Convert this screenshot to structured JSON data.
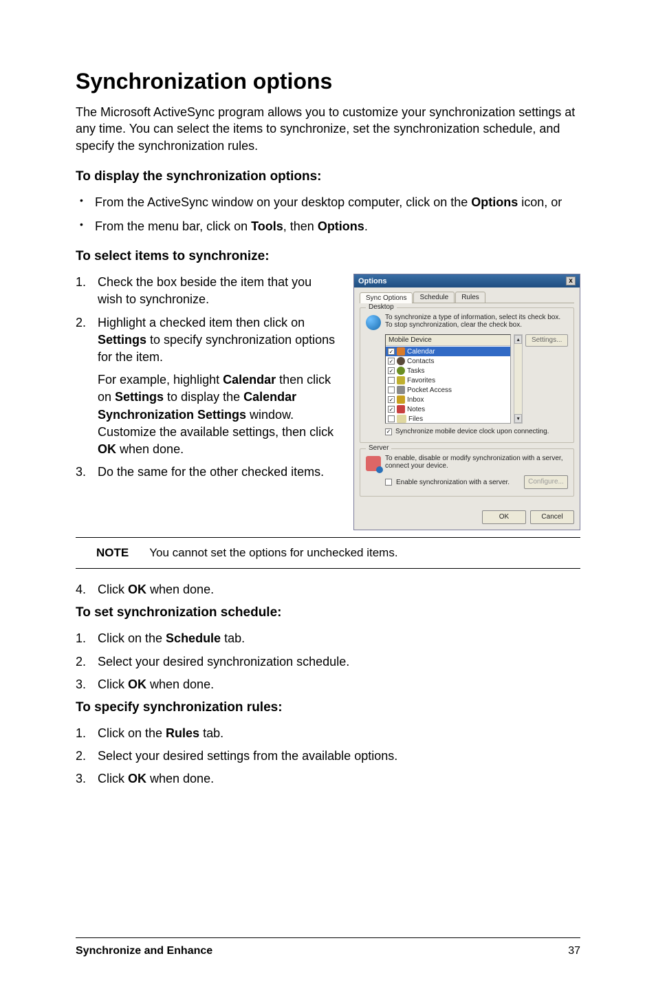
{
  "title": "Synchronization options",
  "intro": "The Microsoft ActiveSync program allows you to customize your synchronization settings at any time. You can select the items to synchronize, set the synchronization schedule, and specify the synchronization rules.",
  "h_display": "To display the synchronization options:",
  "display_bullets": {
    "b1_pre": "From the ActiveSync window on your desktop computer, click on the ",
    "b1_bold": "Options",
    "b1_post": " icon, or",
    "b2_pre": "From the menu bar, click on ",
    "b2_bold1": "Tools",
    "b2_mid": ", then ",
    "b2_bold2": "Options",
    "b2_post": "."
  },
  "h_select": "To select items to synchronize:",
  "select_steps": {
    "s1": "Check the box beside the item that you wish to synchronize.",
    "s2_pre": "Highlight a checked item then click on ",
    "s2_bold": "Settings",
    "s2_post": " to specify synchronization options for the item.",
    "s2_sub_pre": "For example, highlight ",
    "s2_sub_b1": "Calendar",
    "s2_sub_mid1": " then click on ",
    "s2_sub_b2": "Settings",
    "s2_sub_mid2": " to display the ",
    "s2_sub_b3": "Calendar Synchronization Settings",
    "s2_sub_mid3": " window. Customize the available settings, then click ",
    "s2_sub_b4": "OK",
    "s2_sub_post": " when done.",
    "s3": "Do the same for the other checked items."
  },
  "note_label": "NOTE",
  "note_text": "You cannot set the options for unchecked items.",
  "step4_pre": "Click ",
  "step4_bold": "OK",
  "step4_post": " when done.",
  "h_schedule": "To set synchronization schedule:",
  "schedule_steps": {
    "s1_pre": "Click on the ",
    "s1_bold": "Schedule",
    "s1_post": " tab.",
    "s2": "Select your desired synchronization schedule.",
    "s3_pre": "Click ",
    "s3_bold": "OK",
    "s3_post": " when done."
  },
  "h_rules": "To specify synchronization rules:",
  "rules_steps": {
    "s1_pre": "Click on the ",
    "s1_bold": "Rules",
    "s1_post": " tab.",
    "s2": "Select your desired settings from the available options.",
    "s3_pre": "Click ",
    "s3_bold": "OK",
    "s3_post": " when done."
  },
  "footer": {
    "title": "Synchronize and Enhance",
    "page": "37"
  },
  "dialog": {
    "title": "Options",
    "close": "x",
    "tabs": {
      "t1": "Sync Options",
      "t2": "Schedule",
      "t3": "Rules"
    },
    "desktop": {
      "legend": "Desktop",
      "msg": "To synchronize a type of information, select its check box. To stop synchronization, clear the check box.",
      "header": "Mobile Device",
      "settings_btn": "Settings...",
      "items": [
        {
          "label": "Calendar",
          "checked": true,
          "selected": true,
          "icon": "cal"
        },
        {
          "label": "Contacts",
          "checked": true,
          "selected": false,
          "icon": "cont"
        },
        {
          "label": "Tasks",
          "checked": true,
          "selected": false,
          "icon": "task"
        },
        {
          "label": "Favorites",
          "checked": false,
          "selected": false,
          "icon": "fav"
        },
        {
          "label": "Pocket Access",
          "checked": false,
          "selected": false,
          "icon": "pa"
        },
        {
          "label": "Inbox",
          "checked": true,
          "selected": false,
          "icon": "inbox"
        },
        {
          "label": "Notes",
          "checked": true,
          "selected": false,
          "icon": "notes"
        },
        {
          "label": "Files",
          "checked": false,
          "selected": false,
          "icon": "files"
        }
      ],
      "clock_chk": "Synchronize mobile device clock upon connecting."
    },
    "server": {
      "legend": "Server",
      "msg": "To enable, disable or modify synchronization with a server, connect your device.",
      "enable_label": "Enable synchronization with a server.",
      "config_btn": "Configure..."
    },
    "buttons": {
      "ok": "OK",
      "cancel": "Cancel"
    }
  }
}
